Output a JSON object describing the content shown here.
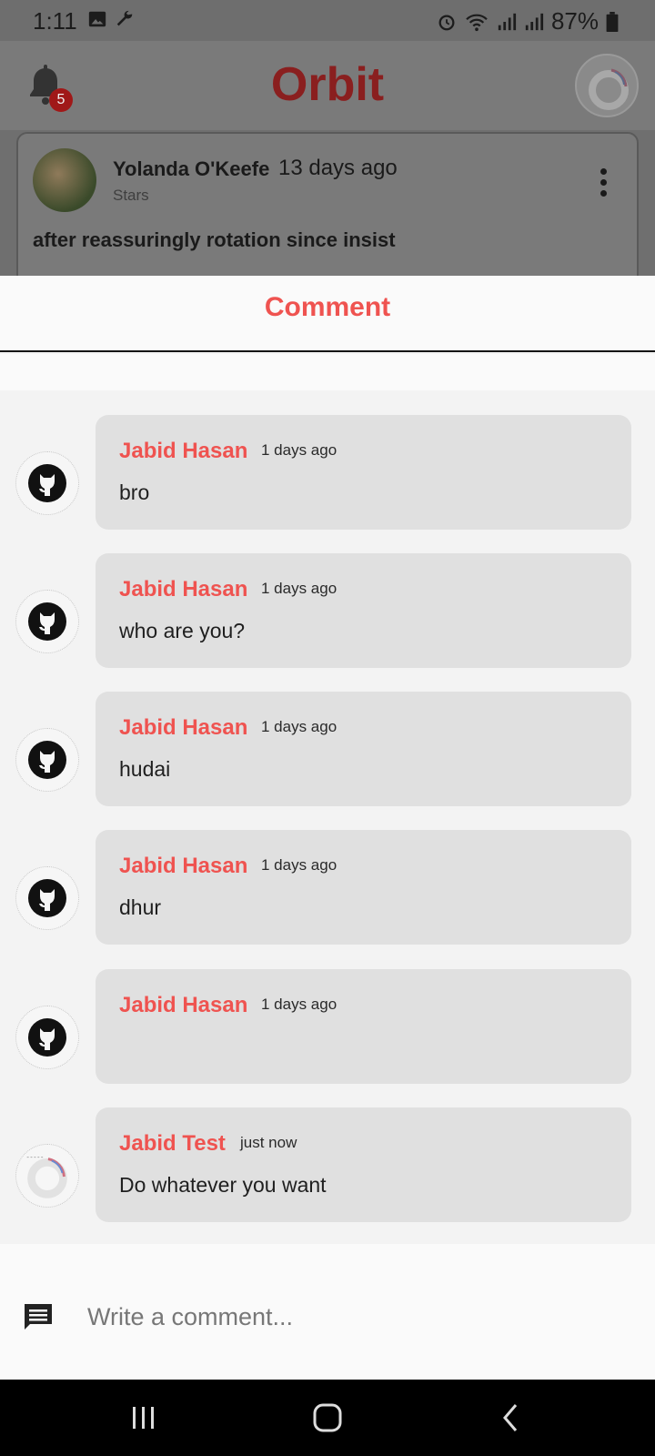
{
  "status_bar": {
    "time": "1:11",
    "battery": "87%"
  },
  "app_bar": {
    "title": "Orbit",
    "notification_count": "5"
  },
  "post": {
    "author": "Yolanda O'Keefe",
    "time": "13 days ago",
    "subtitle": "Stars",
    "title": "after reassuringly rotation since insist"
  },
  "sheet": {
    "title": "Comment"
  },
  "comments": [
    {
      "name": "Jabid Hasan",
      "time": "1 days ago",
      "text": "bro",
      "avatar": "github-icon"
    },
    {
      "name": "Jabid Hasan",
      "time": "1 days ago",
      "text": "who are you?",
      "avatar": "github-icon"
    },
    {
      "name": "Jabid Hasan",
      "time": "1 days ago",
      "text": "hudai",
      "avatar": "github-icon"
    },
    {
      "name": "Jabid Hasan",
      "time": "1 days ago",
      "text": "dhur",
      "avatar": "github-icon"
    },
    {
      "name": "Jabid Hasan",
      "time": "1 days ago",
      "text": "",
      "avatar": "github-icon"
    },
    {
      "name": "Jabid Test",
      "time": "just now",
      "text": "Do whatever you want",
      "avatar": "profile-picture"
    }
  ],
  "input": {
    "placeholder": "Write a comment..."
  },
  "colors": {
    "accent": "#ef5350",
    "bubble": "#e0e0e0",
    "nav": "#000000"
  }
}
